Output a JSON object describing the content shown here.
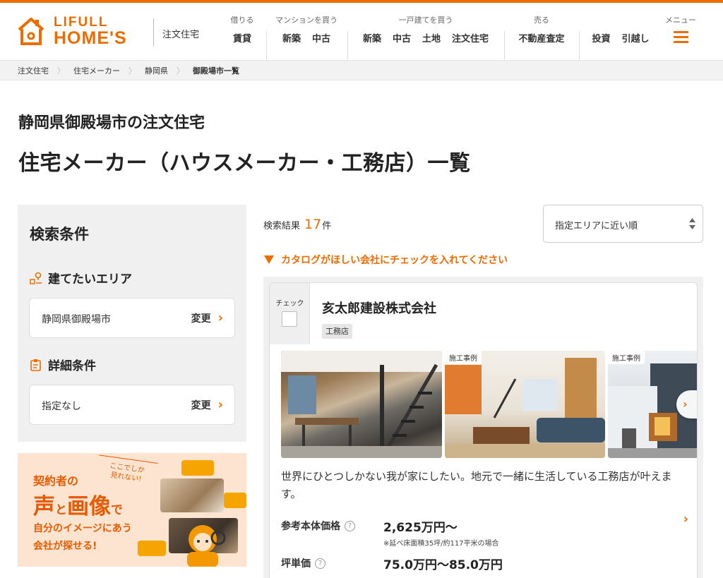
{
  "header": {
    "logo_line1": "LIFULL",
    "logo_line2": "HOME'S",
    "logo_sub": "注文住宅",
    "nav_groups": [
      {
        "caption": "借りる",
        "links": [
          "賃貸"
        ]
      },
      {
        "caption": "マンションを買う",
        "links": [
          "新築",
          "中古"
        ]
      },
      {
        "caption": "一戸建てを買う",
        "links": [
          "新築",
          "中古",
          "土地",
          "注文住宅"
        ]
      },
      {
        "caption": "売る",
        "links": [
          "不動産査定"
        ]
      },
      {
        "caption": "",
        "links": [
          "投資",
          "引越し"
        ]
      }
    ],
    "menu_caption": "メニュー"
  },
  "breadcrumb": [
    "注文住宅",
    "住宅メーカー",
    "静岡県",
    "御殿場市一覧"
  ],
  "page": {
    "title_line1": "静岡県御殿場市の注文住宅",
    "title_line2": "住宅メーカー（ハウスメーカー・工務店）一覧"
  },
  "sidebar": {
    "title": "検索条件",
    "area_heading": "建てたいエリア",
    "area_value": "静岡県御殿場市",
    "area_change": "変更",
    "detail_heading": "詳細条件",
    "detail_value": "指定なし",
    "detail_change": "変更",
    "banner": {
      "line1": "契約者の",
      "bubble": "ここでしか\n見れない!",
      "line2a": "声",
      "line2b": "と",
      "line2c": "画像",
      "line2d": "で",
      "line3": "自分のイメージにあう",
      "line4": "会社が探せる!"
    }
  },
  "results": {
    "label": "検索結果",
    "count": "17",
    "unit": "件",
    "sort_selected": "指定エリアに近い順",
    "hint": "カタログがほしい会社にチェックを入れてください"
  },
  "listing": {
    "check_label": "チェック",
    "company_name": "亥太郎建設株式会社",
    "company_type": "工務店",
    "photo_label": "施工事例",
    "description": "世界にひとつしかない我が家にしたい。地元で一緒に生活している工務店が叶えます。",
    "price_label": "参考本体価格",
    "price_value": "2,625万円〜",
    "price_note": "※延べ床面積35坪/約117平米の場合",
    "tsubo_label": "坪単価",
    "tsubo_value": "75.0万円〜85.0万円"
  },
  "colors": {
    "accent": "#ED6C00"
  }
}
